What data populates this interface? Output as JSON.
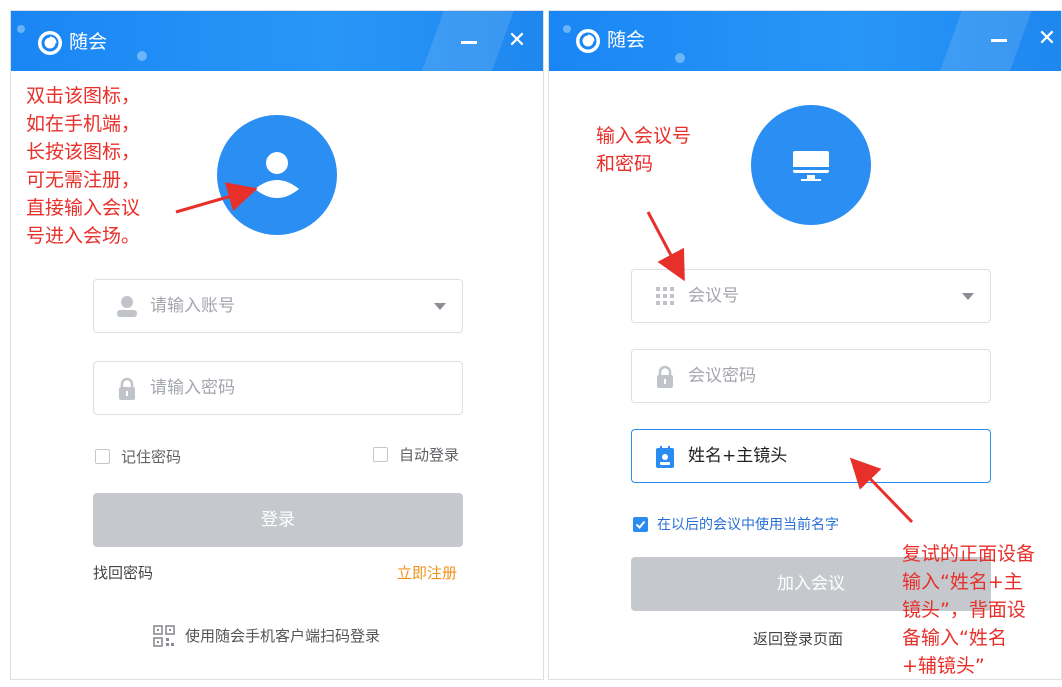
{
  "left_window": {
    "title": "随会",
    "username_placeholder": "请输入账号",
    "password_placeholder": "请输入密码",
    "remember_label": "记住密码",
    "auto_login_label": "自动登录",
    "login_button": "登录",
    "forgot_link": "找回密码",
    "register_link": "立即注册",
    "qr_login_text": "使用随会手机客户端扫码登录"
  },
  "right_window": {
    "title": "随会",
    "meeting_id_placeholder": "会议号",
    "meeting_password_placeholder": "会议密码",
    "name_value": "姓名+主镜头",
    "use_name_label": "在以后的会议中使用当前名字",
    "join_button": "加入会议",
    "back_link": "返回登录页面"
  },
  "annotations": {
    "left": "双击该图标，\n如在手机端，\n长按该图标，\n可无需注册，\n直接输入会议\n号进入会场。",
    "right_top": "输入会议号\n和密码",
    "right_bottom": "复试的正面设备\n输入“姓名+主\n镜头”，背面设\n备输入“姓名\n+辅镜头”"
  },
  "colors": {
    "brand_blue": "#1a86f5",
    "annotation_red": "#e8302b",
    "register_orange": "#f0901c",
    "disabled_button": "#c5c8cd"
  },
  "icons": [
    "app-logo-icon",
    "minimize-icon",
    "close-icon",
    "user-avatar-icon",
    "monitor-icon",
    "person-icon",
    "lock-icon",
    "keypad-icon",
    "badge-icon",
    "dropdown-caret-icon",
    "qr-code-icon",
    "checkmark-icon"
  ]
}
